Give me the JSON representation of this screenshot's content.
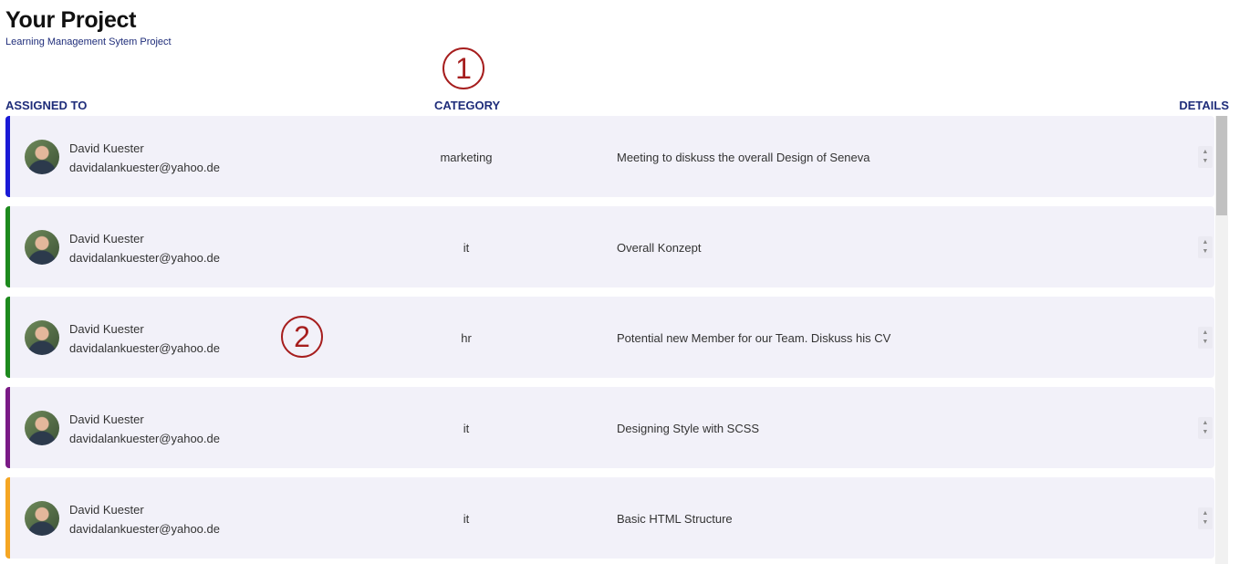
{
  "header": {
    "title": "Your Project",
    "subtitle": "Learning Management Sytem Project"
  },
  "markers": [
    "1",
    "2"
  ],
  "columns": {
    "assigned_to": "ASSIGNED TO",
    "category": "CATEGORY",
    "details": "DETAILS"
  },
  "rows": [
    {
      "name": "David Kuester",
      "email": "davidalankuester@yahoo.de",
      "category": "marketing",
      "detail": "Meeting to diskuss the overall Design of Seneva",
      "accent": "#1a1ad6"
    },
    {
      "name": "David Kuester",
      "email": "davidalankuester@yahoo.de",
      "category": "it",
      "detail": "Overall Konzept",
      "accent": "#1d8a1d"
    },
    {
      "name": "David Kuester",
      "email": "davidalankuester@yahoo.de",
      "category": "hr",
      "detail": "Potential new Member for our Team. Diskuss his CV",
      "accent": "#1d8a1d"
    },
    {
      "name": "David Kuester",
      "email": "davidalankuester@yahoo.de",
      "category": "it",
      "detail": "Designing Style with SCSS",
      "accent": "#7a1a86"
    },
    {
      "name": "David Kuester",
      "email": "davidalankuester@yahoo.de",
      "category": "it",
      "detail": "Basic HTML Structure",
      "accent": "#f5a623"
    }
  ],
  "icons": {
    "avatar": "user-photo",
    "stepper": "up-down-stepper-icon"
  }
}
